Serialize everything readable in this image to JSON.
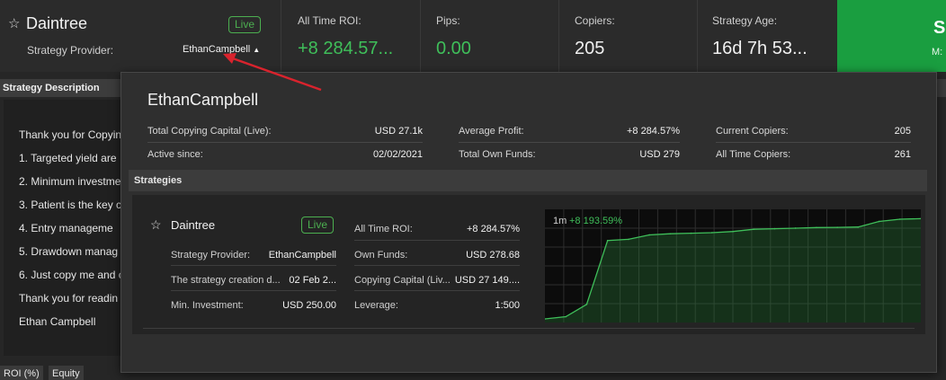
{
  "header": {
    "title": "Daintree",
    "live_label": "Live",
    "provider_label": "Strategy Provider:",
    "provider_name": "EthanCampbell",
    "stats": [
      {
        "label": "All Time ROI:",
        "value": "+8 284.57..."
      },
      {
        "label": "Pips:",
        "value": "0.00"
      },
      {
        "label": "Copiers:",
        "value": "205"
      },
      {
        "label": "Strategy Age:",
        "value": "16d 7h 53..."
      }
    ],
    "cta_letter": "S",
    "cta_sub": "M:"
  },
  "description": {
    "heading": "Strategy Description",
    "lines": [
      "Thank you for Copyin",
      "1. Targeted yield are",
      "2. Minimum investme",
      "3. Patient is the key c",
      "4. Entry manageme",
      "5. Drawdown manag",
      "6. Just copy me and c",
      "Thank you for readin",
      "Ethan Campbell"
    ]
  },
  "tabs": [
    "ROI (%)",
    "Equity"
  ],
  "popup": {
    "name": "EthanCampbell",
    "stats": [
      {
        "label": "Total Copying Capital (Live):",
        "value": "USD 27.1k"
      },
      {
        "label": "Average Profit:",
        "value": "+8 284.57%"
      },
      {
        "label": "Current Copiers:",
        "value": "205"
      },
      {
        "label": "Active since:",
        "value": "02/02/2021"
      },
      {
        "label": "Total Own Funds:",
        "value": "USD 279"
      },
      {
        "label": "All Time Copiers:",
        "value": "261"
      }
    ],
    "strategies_heading": "Strategies",
    "strategy": {
      "name": "Daintree",
      "live_label": "Live",
      "left_rows": [
        {
          "label": "Strategy Provider:",
          "value": "EthanCampbell"
        },
        {
          "label": "The strategy creation d...",
          "value": "02 Feb 2..."
        },
        {
          "label": "Min. Investment:",
          "value": "USD 250.00"
        }
      ],
      "right_rows": [
        {
          "label": "All Time ROI:",
          "value": "+8 284.57%"
        },
        {
          "label": "Own Funds:",
          "value": "USD 278.68"
        },
        {
          "label": "Copying Capital (Liv...",
          "value": "USD 27 149...."
        },
        {
          "label": "Leverage:",
          "value": "1:500"
        }
      ],
      "chart_period": "1m",
      "chart_change": "+8 193.59%"
    }
  },
  "colors": {
    "accent_green": "#3fbf5a",
    "cta_green": "#1a9e40",
    "arrow_red": "#d9232d"
  },
  "chart_data": {
    "type": "area",
    "title": "",
    "x": [
      0,
      1,
      2,
      3,
      4,
      5,
      6,
      7,
      8,
      9,
      10,
      11,
      12,
      13,
      14,
      15,
      16,
      17,
      18
    ],
    "values": [
      0,
      200,
      1300,
      7000,
      7100,
      7500,
      7600,
      7650,
      7700,
      7800,
      8000,
      8050,
      8100,
      8150,
      8170,
      8200,
      8700,
      8900,
      8950
    ],
    "series": [
      {
        "values": [
          0,
          200,
          1300,
          7000,
          7100,
          7500,
          7600,
          7650,
          7700,
          7800,
          8000,
          8050,
          8100,
          8150,
          8170,
          8200,
          8700,
          8900,
          8950
        ]
      }
    ],
    "ylim": [
      0,
      9300
    ],
    "grid": true,
    "xlabel": "",
    "ylabel": ""
  }
}
